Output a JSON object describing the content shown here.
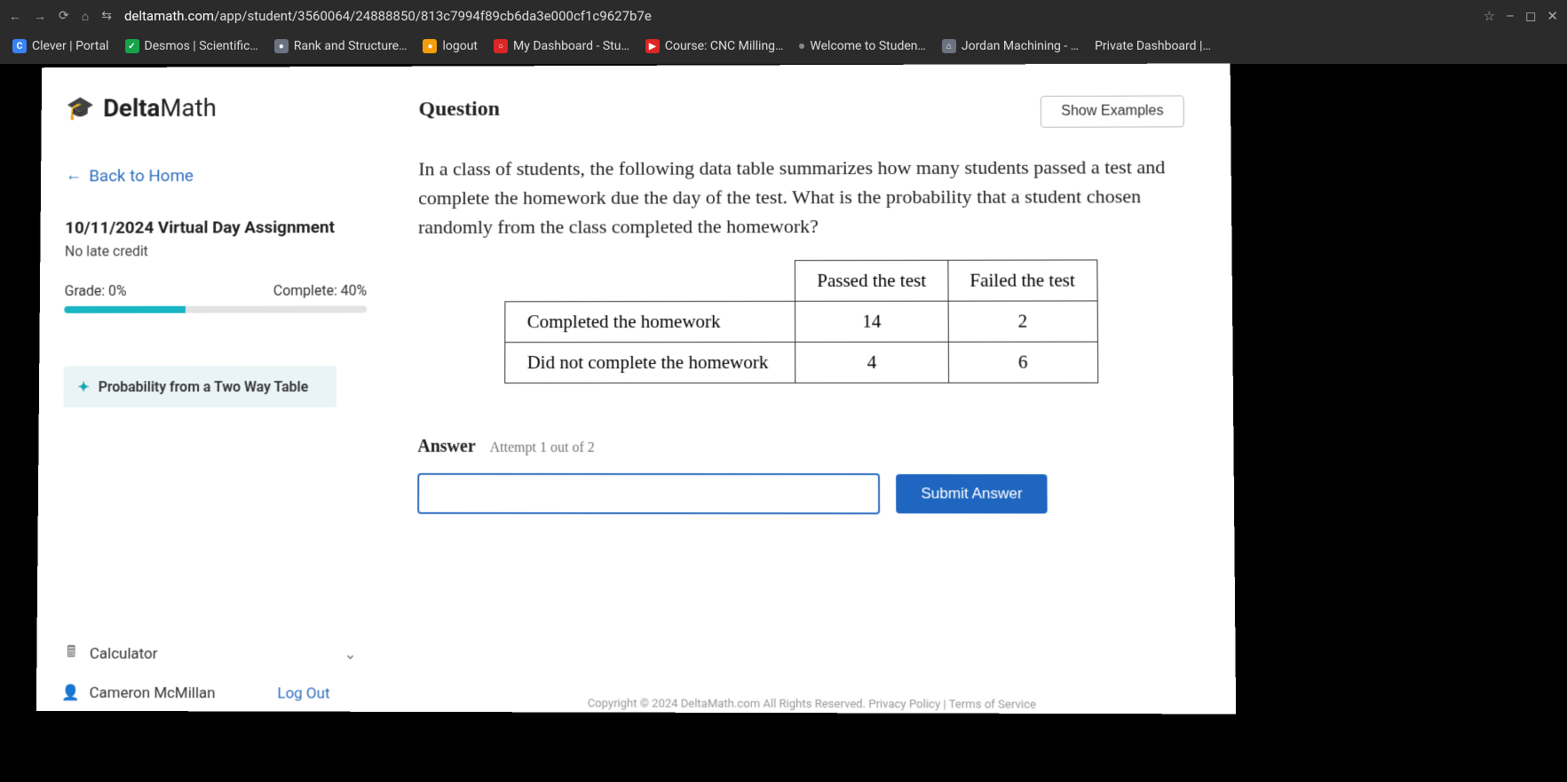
{
  "browser": {
    "url_prefix": "deltamath.com",
    "url_path": "/app/student/3560064/24888850/813c7994f89cb6da3e000cf1c9627b7e",
    "bookmarks": [
      {
        "label": "Clever | Portal",
        "iconClass": "bm-blue",
        "iconText": "C"
      },
      {
        "label": "Desmos | Scientific…",
        "iconClass": "bm-green",
        "iconText": "✓"
      },
      {
        "label": "Rank and Structure…",
        "iconClass": "bm-gray",
        "iconText": "●"
      },
      {
        "label": "logout",
        "iconClass": "bm-orange",
        "iconText": "●"
      },
      {
        "label": "My Dashboard - Stu…",
        "iconClass": "bm-red",
        "iconText": "○"
      },
      {
        "label": "Course: CNC Milling…",
        "iconClass": "bm-red",
        "iconText": "▶"
      },
      {
        "label": "Welcome to Studen…",
        "iconClass": "",
        "iconText": "•"
      },
      {
        "label": "Jordan Machining - …",
        "iconClass": "bm-gray",
        "iconText": "⌂"
      },
      {
        "label": "Private Dashboard |…",
        "iconClass": "",
        "iconText": ""
      }
    ]
  },
  "sidebar": {
    "logo_delta": "Delta",
    "logo_math": "Math",
    "back_label": "Back to Home",
    "assignment_title": "10/11/2024 Virtual Day Assignment",
    "sub_note": "No late credit",
    "grade_label": "Grade: 0%",
    "complete_label": "Complete: 40%",
    "progress_percent": 40,
    "topic_label": "Probability from a Two Way Table",
    "calculator_label": "Calculator",
    "user_name": "Cameron McMillan",
    "logout_label": "Log Out"
  },
  "main": {
    "question_heading": "Question",
    "show_examples_label": "Show Examples",
    "prompt": "In a class of students, the following data table summarizes how many students passed a test and complete the homework due the day of the test. What is the probability that a student chosen randomly from the class completed the homework?",
    "table": {
      "col_headers": [
        "Passed the test",
        "Failed the test"
      ],
      "rows": [
        {
          "label": "Completed the homework",
          "values": [
            "14",
            "2"
          ]
        },
        {
          "label": "Did not complete the homework",
          "values": [
            "4",
            "6"
          ]
        }
      ]
    },
    "answer_label": "Answer",
    "attempt_text": "Attempt 1 out of 2",
    "submit_label": "Submit Answer",
    "footer": "Copyright © 2024 DeltaMath.com All Rights Reserved.   Privacy Policy | Terms of Service"
  }
}
